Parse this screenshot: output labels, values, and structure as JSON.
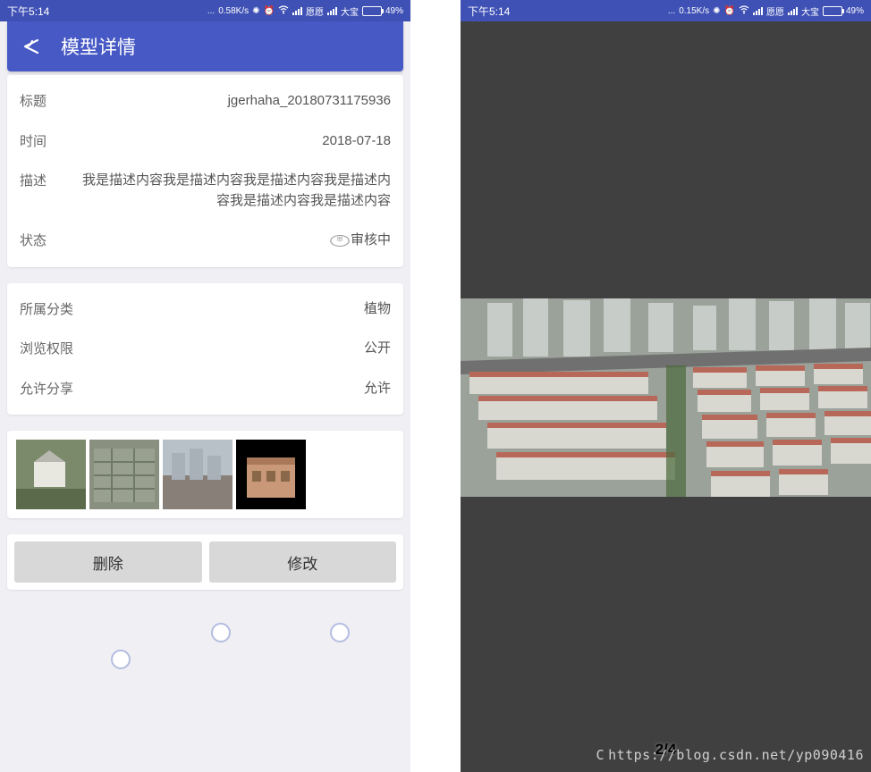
{
  "status_bar": {
    "time": "下午5:14",
    "speed_left": "0.58K/s",
    "speed_right": "0.15K/s",
    "carrier1": "愿愿",
    "carrier2": "大宝",
    "battery": "49%"
  },
  "header": {
    "title": "模型详情"
  },
  "info": {
    "title_label": "标题",
    "title_value": "jgerhaha_20180731175936",
    "time_label": "时间",
    "time_value": "2018-07-18",
    "desc_label": "描述",
    "desc_value": "我是描述内容我是描述内容我是描述内容我是描述内容我是描述内容我是描述内容",
    "status_label": "状态",
    "status_value": "审核中"
  },
  "meta": {
    "category_label": "所属分类",
    "category_value": "植物",
    "perm_label": "浏览权限",
    "perm_value": "公开",
    "share_label": "允许分享",
    "share_value": "允许"
  },
  "thumbnails": [
    "thumb-1",
    "thumb-2",
    "thumb-3",
    "thumb-4"
  ],
  "buttons": {
    "delete": "删除",
    "edit": "修改"
  },
  "viewer": {
    "pager": "2/4"
  },
  "watermark": "https://blog.csdn.net/yp090416"
}
